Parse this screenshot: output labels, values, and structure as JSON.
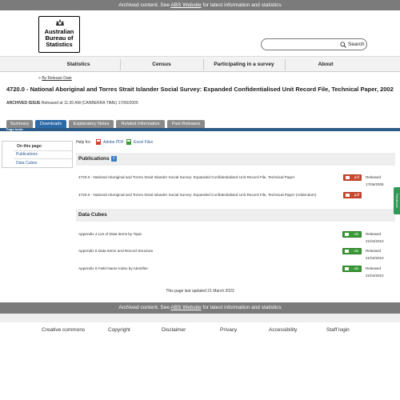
{
  "archive_notice": {
    "prefix": "Archived content. See ",
    "link": "ABS Website",
    "suffix": " for latest information and statistics"
  },
  "logo": {
    "line1": "Australian",
    "line2": "Bureau of",
    "line3": "Statistics"
  },
  "search": {
    "placeholder": "",
    "button_label": "Search"
  },
  "nav": {
    "items": [
      "Statistics",
      "Census",
      "Participating in a survey",
      "About"
    ]
  },
  "breadcrumb": {
    "prefix": "> ",
    "link": "By Release Date"
  },
  "page": {
    "title": "4720.0 - National Aboriginal and Torres Strait Islander Social Survey: Expanded Confidentialised Unit Record File, Technical Paper, 2002",
    "issue_label": "ARCHIVED ISSUE",
    "issue_text": " Released at 11:30 AM (CANBERRA TIME) 17/06/2005"
  },
  "tabs": [
    "Summary",
    "Downloads",
    "Explanatory Notes",
    "Related Information",
    "Past Releases"
  ],
  "active_tab": "Downloads",
  "page_tools_label": "Page tools:",
  "sidebar": {
    "title": "On this page:",
    "links": [
      "Publications",
      "Data Cubes"
    ]
  },
  "help": {
    "label": "Help for:",
    "adobe": "Adobe PDF",
    "excel": "Excel Files"
  },
  "publications": {
    "heading": "Publications",
    "info_icon": "i",
    "items": [
      {
        "text": "4720.0 - National Aboriginal and Torres Strait Islander Social Survey: Expanded Confidentialised Unit Record File, Technical Paper",
        "badge": "pdf",
        "released_label": "Released",
        "released_date": "17/06/2005"
      },
      {
        "text": "4720.0 - National Aboriginal and Torres Strait Islander Social Survey: Expanded Confidentialised Unit Record File, Technical Paper (Addendum)",
        "badge": "pdf",
        "released_label": "",
        "released_date": ""
      }
    ]
  },
  "data_cubes": {
    "heading": "Data Cubes",
    "items": [
      {
        "text": "Appendix 4 List of Data items by Topic",
        "badge": "xls",
        "released_label": "Released",
        "released_date": "21/04/2010"
      },
      {
        "text": "Appendix 5 Data Items and Record Structure",
        "badge": "xls",
        "released_label": "Released",
        "released_date": "21/04/2010"
      },
      {
        "text": "Appendix 6 Field Name Index by Identifier",
        "badge": "xls",
        "released_label": "Released",
        "released_date": "21/04/2010"
      }
    ]
  },
  "last_updated": "This page last updated 21 March 2023",
  "footer": {
    "links": [
      "Creative commons",
      "Copyright",
      "Disclaimer",
      "Privacy",
      "Accessibility",
      "Staff login"
    ]
  },
  "feedback_label": "Feedback",
  "colors": {
    "archive_bar": "#7b7b7b",
    "active_tab": "#2c6aa8",
    "tab_bar": "#2c5b87",
    "pdf": "#c9492f",
    "xls": "#3a9b35",
    "link": "#2b5b94",
    "feedback": "#2e9a55"
  }
}
